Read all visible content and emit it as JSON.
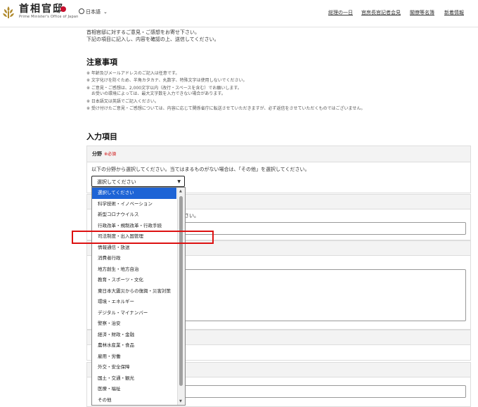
{
  "header": {
    "logo_title": "首相官邸",
    "logo_subtitle": "Prime Minister's Office of Japan",
    "language": "日本語",
    "nav": [
      {
        "label": "総理の一日"
      },
      {
        "label": "官房長官記者会見"
      },
      {
        "label": "閣僚等名簿"
      },
      {
        "label": "新着情報"
      }
    ]
  },
  "intro": {
    "line1": "首相官邸に対するご意見・ご感想をお寄せ下さい。",
    "line2": "下記の項目に記入し、内容を確認の上、送信してください。"
  },
  "notes": {
    "title": "注意事項",
    "items": [
      "※ 年齢及びメールアドレスのご記入は任意です。",
      "※ 文字化けを防ぐため、半角カタカナ、丸数字、特殊文字は使用しないでください。",
      "※ ご意見・ご感想は、2,000文字以内（改行・スペースを含む）でお願いします。",
      "お受いの環境によっては、最大文字数を入力できない場合があります。",
      "※ 日本語又は英語でご記入ください。",
      "※ 受け付けたご意見・ご感想については、内容に応じて関係省庁に転送させていただきますが、必ず返信をさせていただくものではございません。"
    ]
  },
  "form": {
    "title": "入力項目",
    "field_label": "分野",
    "required": "※必須",
    "description": "以下の分野から選択してください。当てはまるものがない場合は、「その他」を選択してください。",
    "select_value": "選択してください",
    "hidden_hint_tail": "さい。",
    "options": [
      "選択してください",
      "科学技術・イノベーション",
      "新型コロナウイルス",
      "行政改革・規制改革・行政手続",
      "司法制度・出入国管理",
      "情報通信・放送",
      "消費者行政",
      "地方創生・地方自治",
      "教育・スポーツ・文化",
      "東日本大震災からの復興・災害対策",
      "環境・エネルギー",
      "デジタル・マイナンバー",
      "警察・治安",
      "経済・財政・金融",
      "農林水産業・食品",
      "雇用・労働",
      "外交・安全保障",
      "国土・交通・観光",
      "医療・福祉",
      "その他"
    ]
  }
}
